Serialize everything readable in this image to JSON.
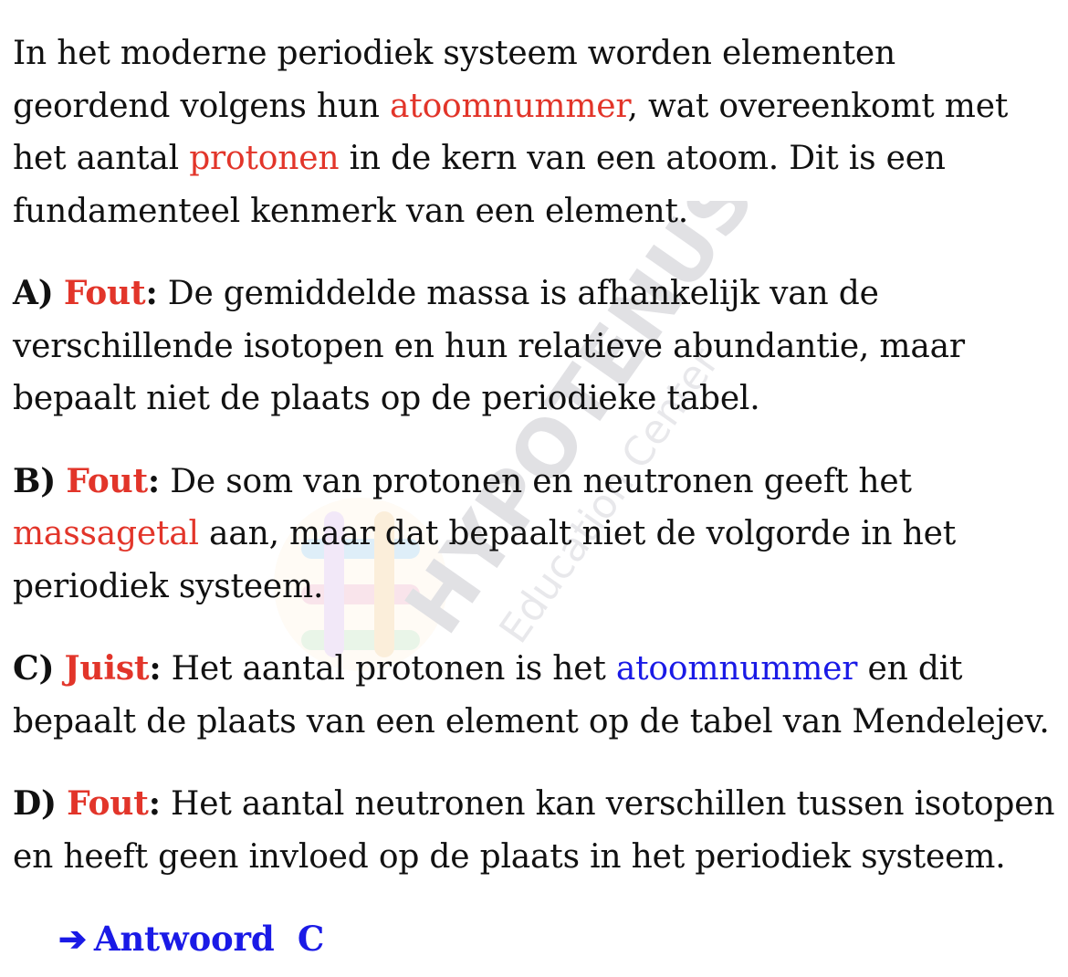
{
  "intro": {
    "t1": "In het moderne periodiek systeem worden elementen geordend volgens hun ",
    "h1": "atoomnummer",
    "t2": ", wat overeenkomt met het aantal ",
    "h2": "protonen",
    "t3": " in de kern van een atoom. Dit is een fundamenteel kenmerk van een element."
  },
  "options": [
    {
      "letter": "A)",
      "verdict": "Fout",
      "colon": ":",
      "text": " De gemiddelde massa is afhankelijk van de verschillende isotopen en hun relatieve abundantie, maar bepaalt niet de plaats op de periodieke tabel."
    },
    {
      "letter": "B)",
      "verdict": "Fout",
      "colon": ":",
      "text_before": " De som van protonen en neutronen geeft het ",
      "highlight": "massagetal",
      "text_after": " aan, maar dat bepaalt niet de volgorde in het periodiek systeem."
    },
    {
      "letter": "C)",
      "verdict": "Juist",
      "colon": ":",
      "text_before": " Het aantal protonen is het ",
      "highlight": "atoomnummer",
      "text_after": " en dit bepaalt de plaats van een element op de tabel van Mendelejev."
    },
    {
      "letter": "D)",
      "verdict": "Fout",
      "colon": ":",
      "text": " Het aantal neutronen kan verschillen tussen isotopen en heeft geen invloed op de plaats in het periodiek systeem."
    }
  ],
  "answer": {
    "arrow": "➔",
    "label": "Antwoord  C"
  },
  "watermark": {
    "brand": "HYPOTENUSE",
    "subtitle": "Education Center"
  },
  "colors": {
    "red": "#e2352a",
    "blue": "#1a1ae6",
    "text": "#111111"
  }
}
